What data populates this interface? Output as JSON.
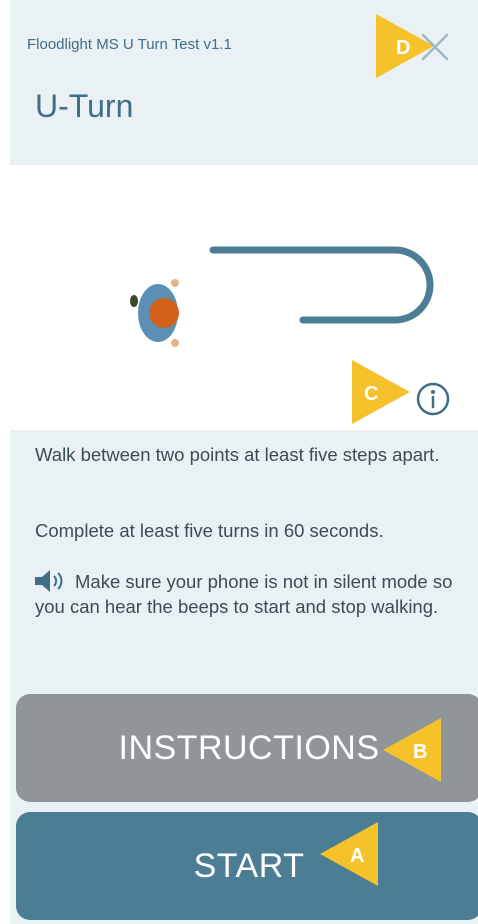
{
  "header": {
    "app_title": "Floodlight MS U Turn Test v1.1",
    "page_title": "U-Turn"
  },
  "markers": {
    "a": "A",
    "b": "B",
    "c": "C",
    "d": "D"
  },
  "description": {
    "line1": "Walk between two points at least five steps apart.",
    "line2": "Complete at least five turns in 60 seconds.",
    "line3": "Make sure your phone is not in silent mode so you can hear the beeps to start and stop walking."
  },
  "buttons": {
    "instructions": "INSTRUCTIONS",
    "start": "START"
  },
  "icons": {
    "close": "close-icon",
    "info": "info-icon",
    "speaker": "speaker-icon"
  },
  "colors": {
    "header_bg": "#e9f1f4",
    "title_text": "#3f6e86",
    "marker_yellow": "#f5c22b",
    "instructions_button": "#8f9598",
    "start_button": "#4b7d95"
  }
}
